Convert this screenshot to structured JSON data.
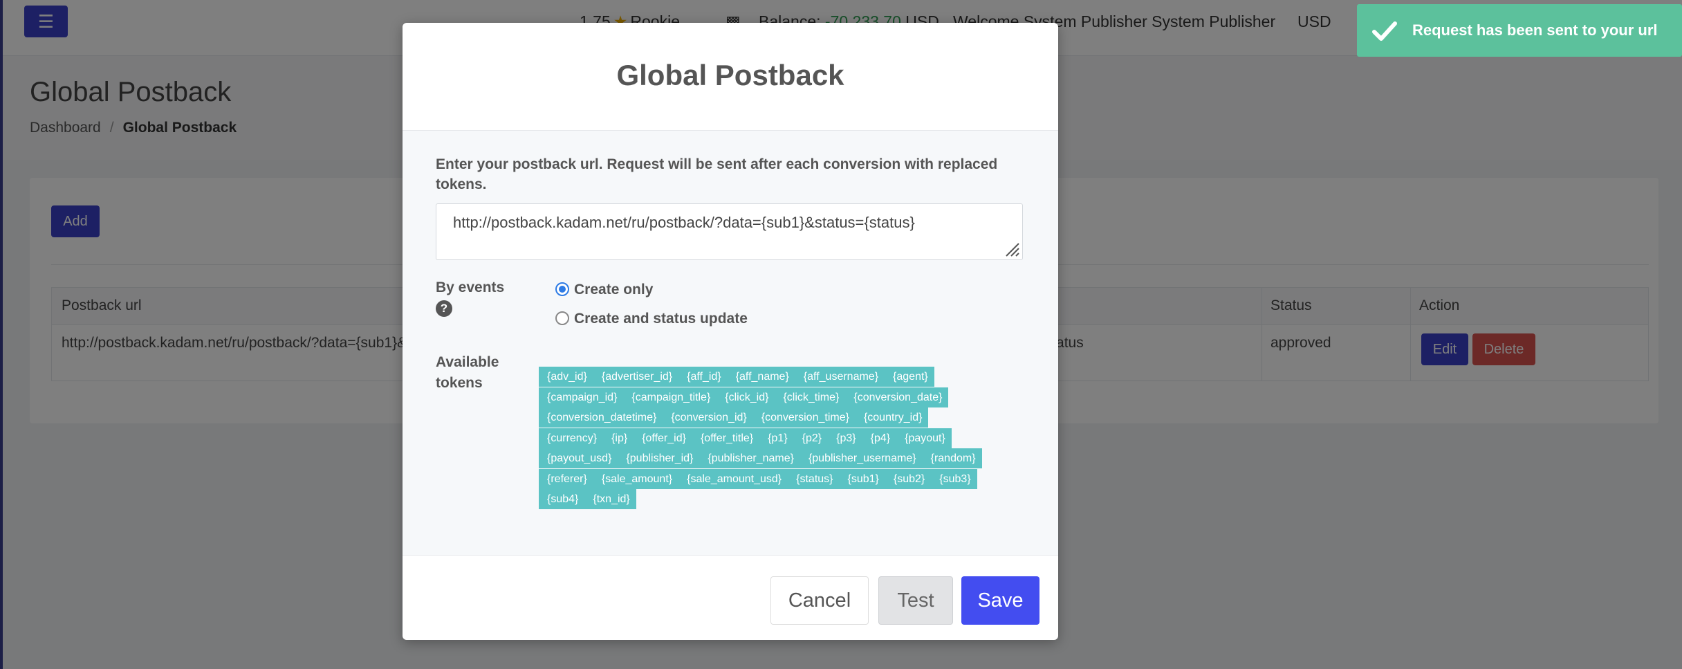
{
  "topbar": {
    "menu_icon": "hamburger-icon",
    "rating_value": "1.75",
    "rating_icon": "star-icon",
    "rank": "Rookie",
    "wallet_icon": "wallet-icon",
    "balance_label": "Balance:",
    "balance_value": "-70 233.70",
    "balance_currency": "USD",
    "welcome": "Welcome System Publisher System Publisher",
    "currency": "USD"
  },
  "page": {
    "title": "Global Postback",
    "breadcrumb": {
      "home": "Dashboard",
      "separator": "/",
      "current": "Global Postback"
    }
  },
  "card": {
    "add_label": "Add",
    "table": {
      "headers": {
        "url": "Postback url",
        "status": "Status",
        "action": "Action"
      },
      "rows": [
        {
          "url": "http://postback.kadam.net/ru/postback/?data={sub1}&status={status}",
          "events": "_status",
          "status": "approved",
          "edit_label": "Edit",
          "delete_label": "Delete"
        }
      ]
    }
  },
  "modal": {
    "title": "Global Postback",
    "instructions": "Enter your postback url. Request will be sent after each conversion with replaced tokens.",
    "url_value": "http://postback.kadam.net/ru/postback/?data={sub1}&status={status}",
    "events_label": "By events",
    "help_icon": "question-circle-icon",
    "options": [
      {
        "label": "Create only",
        "checked": true
      },
      {
        "label": "Create and status update",
        "checked": false
      }
    ],
    "tokens_label": "Available tokens",
    "token_color": "#5bc3c4",
    "token_lines": [
      [
        "{adv_id}",
        "{advertiser_id}",
        "{aff_id}",
        "{aff_name}",
        "{aff_username}",
        "{agent}"
      ],
      [
        "{campaign_id}",
        "{campaign_title}",
        "{click_id}",
        "{click_time}",
        "{conversion_date}"
      ],
      [
        "{conversion_datetime}",
        "{conversion_id}",
        "{conversion_time}",
        "{country_id}"
      ],
      [
        "{currency}",
        "{ip}",
        "{offer_id}",
        "{offer_title}",
        "{p1}",
        "{p2}",
        "{p3}",
        "{p4}",
        "{payout}"
      ],
      [
        "{payout_usd}",
        "{publisher_id}",
        "{publisher_name}",
        "{publisher_username}",
        "{random}"
      ],
      [
        "{referer}",
        "{sale_amount}",
        "{sale_amount_usd}",
        "{status}",
        "{sub1}",
        "{sub2}",
        "{sub3}"
      ],
      [
        "{sub4}",
        "{txn_id}"
      ]
    ],
    "cancel_label": "Cancel",
    "test_label": "Test",
    "save_label": "Save",
    "save_color": "#434df0"
  },
  "toast": {
    "icon": "check-icon",
    "message": "Request has been sent to your url",
    "color": "#5cc19c"
  }
}
